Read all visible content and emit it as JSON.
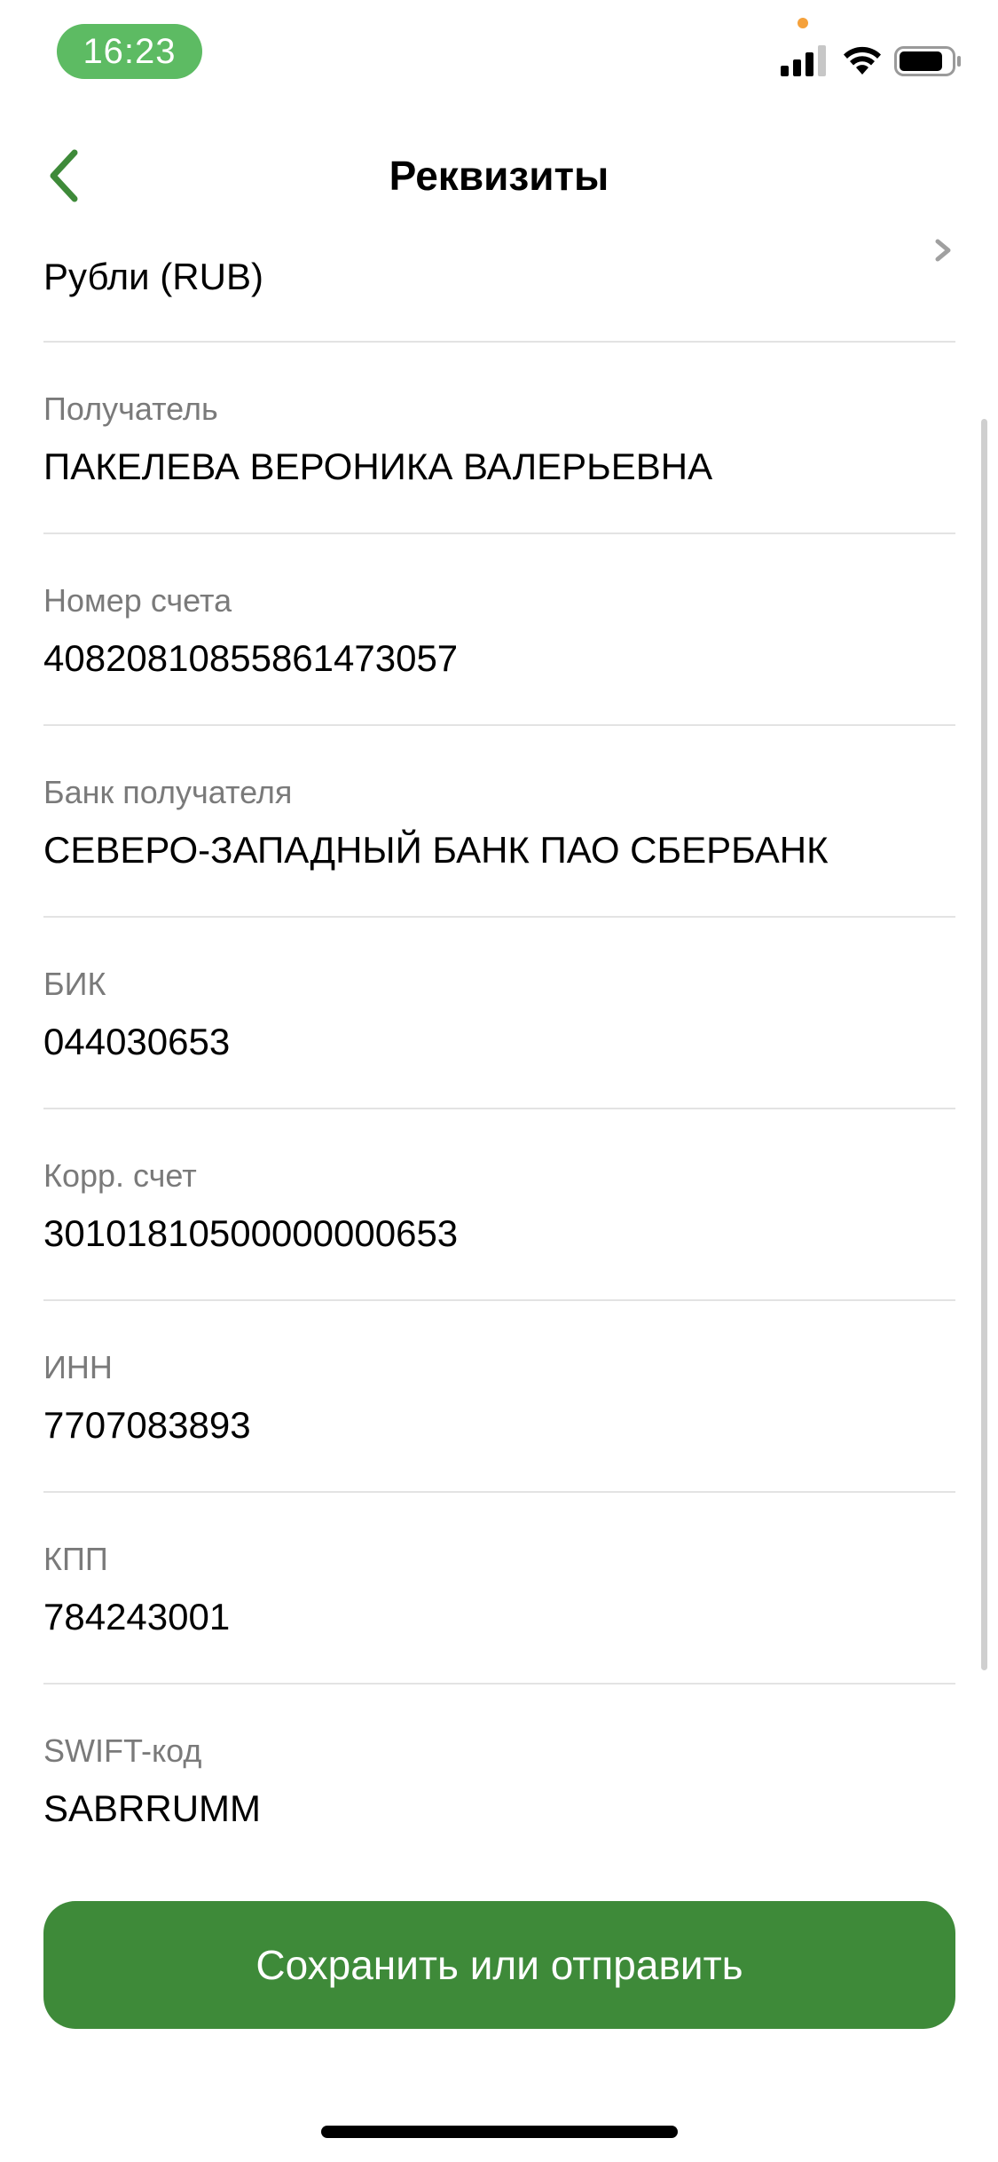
{
  "status_bar": {
    "time": "16:23",
    "icons": [
      "signal-icon",
      "wifi-icon",
      "battery-icon"
    ],
    "time_pill_color": "#5dbb63",
    "privacy_dot_color": "#f5a13b",
    "battery_level": 0.85
  },
  "nav": {
    "title": "Реквизиты",
    "back_icon": "chevron-left-icon",
    "accent_color": "#3e8a39"
  },
  "currency": {
    "value": "Рубли (RUB)",
    "icon": "chevron-right-icon"
  },
  "details": [
    {
      "key": "recipient",
      "label": "Получатель",
      "value": "ПАКЕЛЕВА ВЕРОНИКА ВАЛЕРЬЕВНА"
    },
    {
      "key": "account",
      "label": "Номер счета",
      "value": "40820810855861473057"
    },
    {
      "key": "bank",
      "label": "Банк получателя",
      "value": "СЕВЕРО-ЗАПАДНЫЙ БАНК ПАО СБЕРБАНК"
    },
    {
      "key": "bik",
      "label": "БИК",
      "value": "044030653"
    },
    {
      "key": "corr",
      "label": "Корр. счет",
      "value": "30101810500000000653"
    },
    {
      "key": "inn",
      "label": "ИНН",
      "value": "7707083893"
    },
    {
      "key": "kpp",
      "label": "КПП",
      "value": "784243001"
    },
    {
      "key": "swift",
      "label": "SWIFT-код",
      "value": "SABRRUMM"
    }
  ],
  "actions": {
    "save_or_send_label": "Сохранить или отправить",
    "button_color": "#3e8a39"
  }
}
